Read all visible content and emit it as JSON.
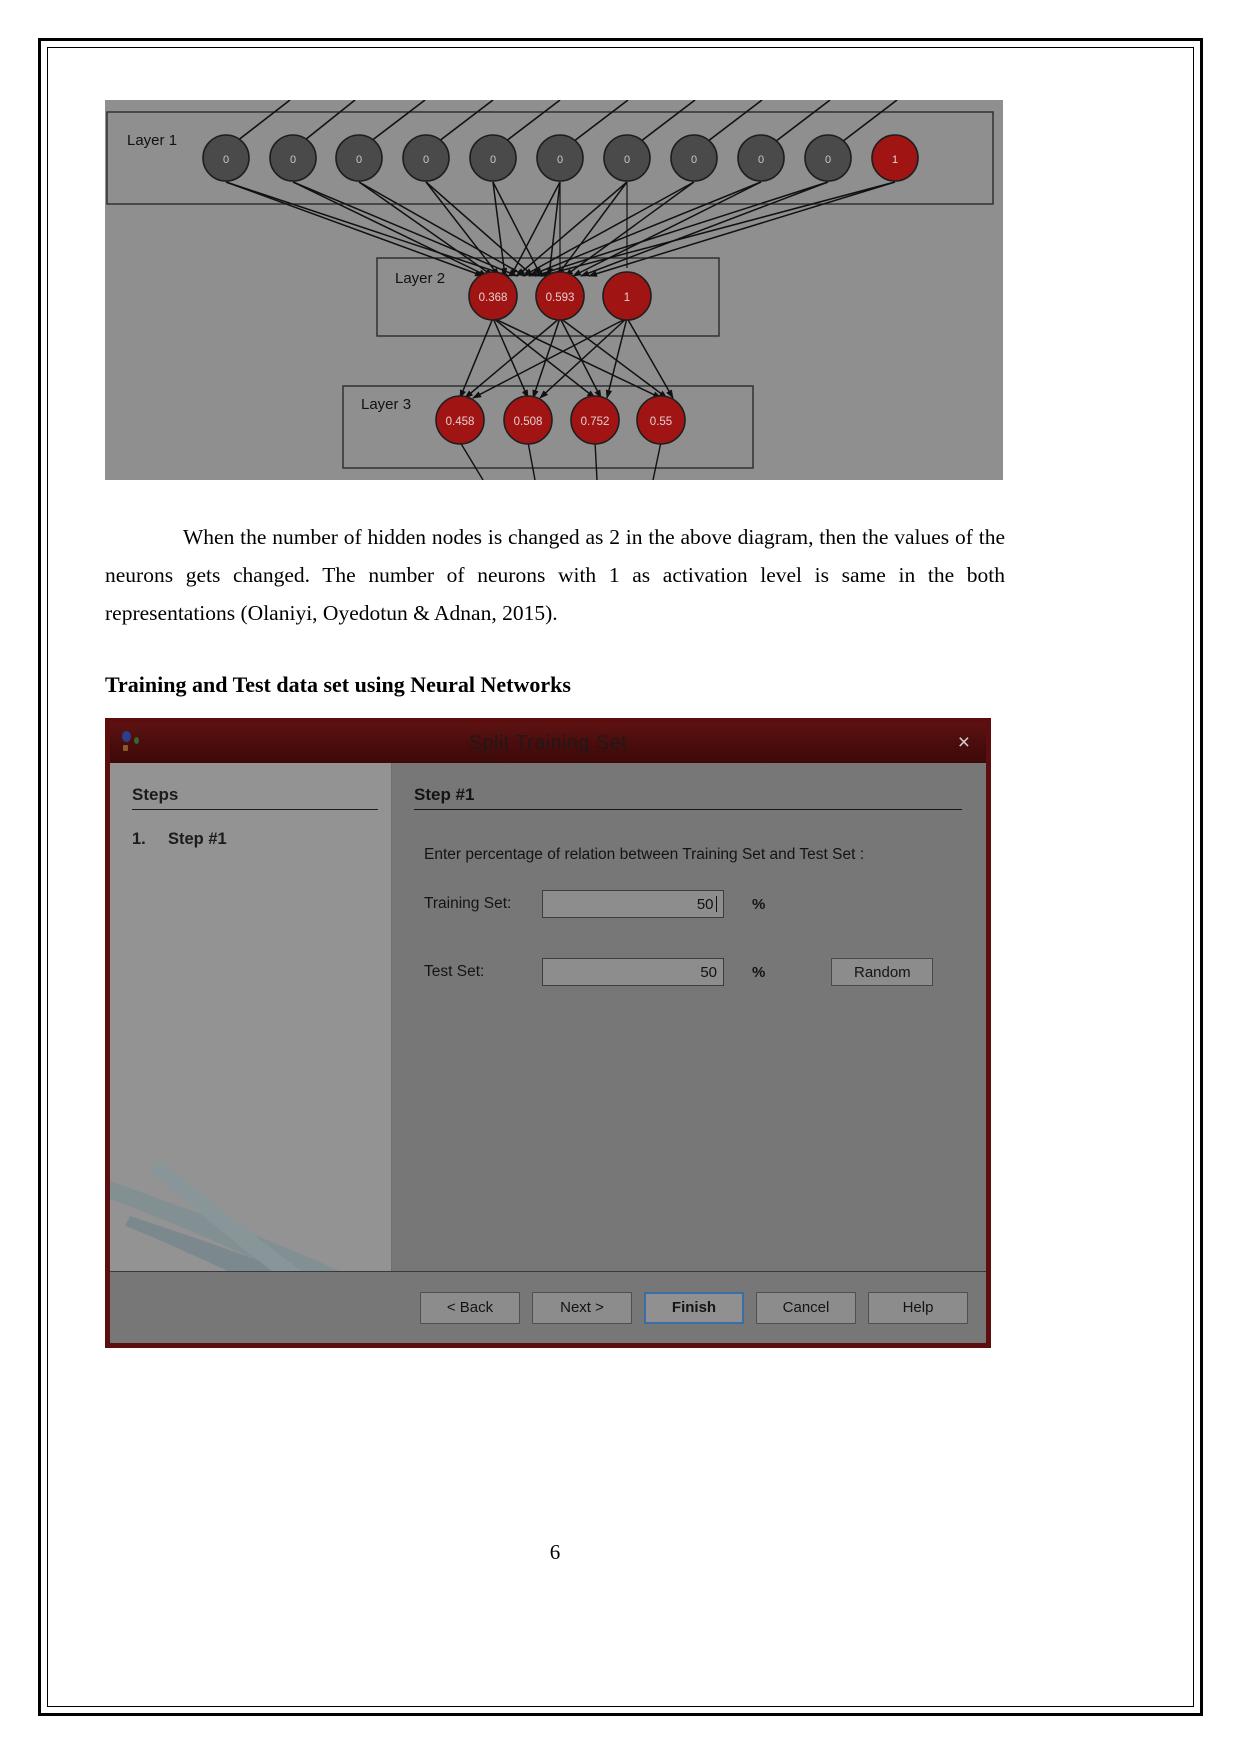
{
  "figure": {
    "background_color": "#8f8f8f",
    "node_inactive_color": "#4a4a4a",
    "node_active_color": "#a01414",
    "layers": [
      {
        "label": "Layer 1",
        "nodes": [
          "0",
          "0",
          "0",
          "0",
          "0",
          "0",
          "0",
          "0",
          "0",
          "0",
          "1"
        ]
      },
      {
        "label": "Layer 2",
        "nodes": [
          "0.368",
          "0.593",
          "1"
        ]
      },
      {
        "label": "Layer 3",
        "nodes": [
          "0.458",
          "0.508",
          "0.752",
          "0.55"
        ]
      }
    ]
  },
  "paragraph": "When the number of hidden nodes is changed as 2 in the above diagram, then the values of the neurons gets changed. The number of neurons with 1 as activation level is same in the both representations (Olaniyi, Oyedotun & Adnan, 2015).",
  "section_heading": "Training and Test data set using Neural Networks",
  "dialog": {
    "title": "Split Training Set",
    "close_label": "×",
    "titlebar_color": "#4a0c0c",
    "sidebar": {
      "heading": "Steps",
      "items": [
        {
          "number": "1.",
          "label": "Step #1"
        }
      ]
    },
    "main": {
      "heading": "Step #1",
      "instruction": "Enter percentage of relation between Training Set and Test Set :",
      "fields": [
        {
          "label": "Training Set:",
          "value": "50",
          "unit": "%",
          "focused": true
        },
        {
          "label": "Test Set:",
          "value": "50",
          "unit": "%",
          "focused": false
        }
      ],
      "random_button": "Random"
    },
    "footer_buttons": [
      {
        "label": "< Back",
        "focused": false
      },
      {
        "label": "Next >",
        "focused": false
      },
      {
        "label": "Finish",
        "focused": true
      },
      {
        "label": "Cancel",
        "focused": false
      },
      {
        "label": "Help",
        "focused": false
      }
    ]
  },
  "page_number": "6"
}
